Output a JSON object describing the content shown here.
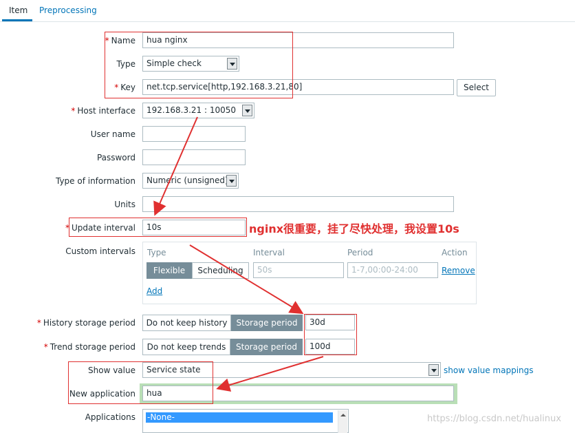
{
  "tabs": {
    "item": "Item",
    "preprocessing": "Preprocessing"
  },
  "form": {
    "name": {
      "label": "Name",
      "value": "hua nginx"
    },
    "type": {
      "label": "Type",
      "value": "Simple check"
    },
    "key": {
      "label": "Key",
      "value": "net.tcp.service[http,192.168.3.21,80]",
      "button": "Select"
    },
    "host_interface": {
      "label": "Host interface",
      "value": "192.168.3.21 : 10050"
    },
    "user_name": {
      "label": "User name",
      "value": ""
    },
    "password": {
      "label": "Password",
      "value": ""
    },
    "type_of_information": {
      "label": "Type of information",
      "value": "Numeric (unsigned)"
    },
    "units": {
      "label": "Units",
      "value": ""
    },
    "update_interval": {
      "label": "Update interval",
      "value": "10s"
    },
    "custom_intervals": {
      "label": "Custom intervals",
      "headers": {
        "type": "Type",
        "interval": "Interval",
        "period": "Period",
        "action": "Action"
      },
      "row": {
        "flexible": "Flexible",
        "scheduling": "Scheduling",
        "interval_placeholder": "50s",
        "period_placeholder": "1-7,00:00-24:00",
        "remove": "Remove"
      },
      "add": "Add"
    },
    "history": {
      "label": "History storage period",
      "no_keep": "Do not keep history",
      "storage": "Storage period",
      "value": "30d"
    },
    "trends": {
      "label": "Trend storage period",
      "no_keep": "Do not keep trends",
      "storage": "Storage period",
      "value": "100d"
    },
    "show_value": {
      "label": "Show value",
      "value": "Service state",
      "link": "show value mappings"
    },
    "new_application": {
      "label": "New application",
      "value": "hua"
    },
    "applications": {
      "label": "Applications",
      "selected": "-None-"
    }
  },
  "annotation": "nginx很重要，挂了尽快处理，我设置10s",
  "watermark": "https://blog.csdn.net/hualinux",
  "colors": {
    "annotation_red": "#e03030",
    "link_blue": "#0275b8",
    "segment_active": "#768d99",
    "highlight_green": "#b9dfb6"
  }
}
